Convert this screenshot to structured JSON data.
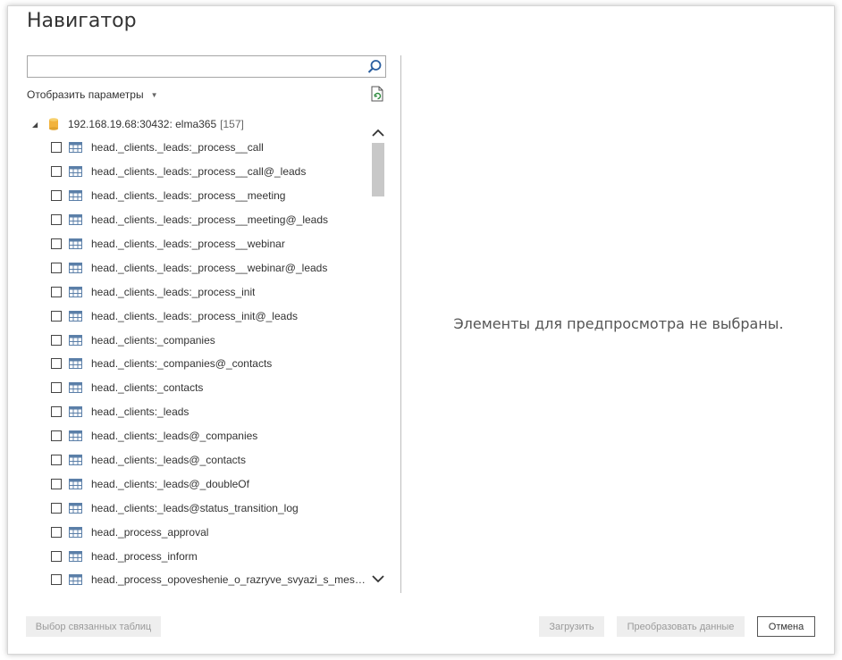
{
  "dialog": {
    "title": "Навигатор"
  },
  "search": {
    "value": "",
    "placeholder": ""
  },
  "options": {
    "label": "Отобразить параметры"
  },
  "tree": {
    "root": {
      "label": "192.168.19.68:30432: elma365",
      "count": "[157]"
    },
    "items": [
      {
        "label": "head._clients._leads:_process__call"
      },
      {
        "label": "head._clients._leads:_process__call@_leads"
      },
      {
        "label": "head._clients._leads:_process__meeting"
      },
      {
        "label": "head._clients._leads:_process__meeting@_leads"
      },
      {
        "label": "head._clients._leads:_process__webinar"
      },
      {
        "label": "head._clients._leads:_process__webinar@_leads"
      },
      {
        "label": "head._clients._leads:_process_init"
      },
      {
        "label": "head._clients._leads:_process_init@_leads"
      },
      {
        "label": "head._clients:_companies"
      },
      {
        "label": "head._clients:_companies@_contacts"
      },
      {
        "label": "head._clients:_contacts"
      },
      {
        "label": "head._clients:_leads"
      },
      {
        "label": "head._clients:_leads@_companies"
      },
      {
        "label": "head._clients:_leads@_contacts"
      },
      {
        "label": "head._clients:_leads@_doubleOf"
      },
      {
        "label": "head._clients:_leads@status_transition_log"
      },
      {
        "label": "head._process_approval"
      },
      {
        "label": "head._process_inform"
      },
      {
        "label": "head._process_opoveshenie_o_razryve_svyazi_s_mess..."
      }
    ]
  },
  "preview": {
    "empty_message": "Элементы для предпросмотра не выбраны."
  },
  "footer": {
    "related_tables_label": "Выбор связанных таблиц",
    "load_label": "Загрузить",
    "transform_label": "Преобразовать данные",
    "cancel_label": "Отмена"
  },
  "colors": {
    "db_icon": "#f2b33d",
    "table_icon": "#5b7fa8",
    "search_icon": "#2b5fa0"
  }
}
